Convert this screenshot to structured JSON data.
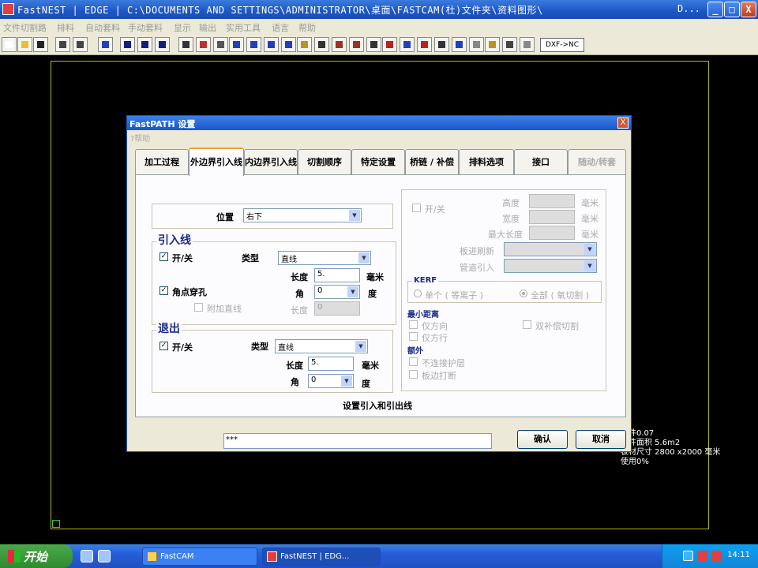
{
  "window": {
    "title": "FastNEST   |  EDGE   |  C:\\DOCUMENTS AND SETTINGS\\ADMINISTRATOR\\桌面\\FASTCAM(杜)文件夹\\资料图形\\",
    "title_suffix": "D...",
    "minimize": "_",
    "maximize": "□",
    "close": "X"
  },
  "menu": [
    "文件切割路",
    "排料",
    "自动套料",
    "手动套料",
    "显示",
    "输出",
    "实用工具",
    "语言",
    "帮助"
  ],
  "toolbar": {
    "dxf_label": "DXF->NC"
  },
  "canvas_info": {
    "line1": "零件0.07",
    "line2": "零件面积 5.6m2",
    "line3": "板材尺寸   2800 x2000 毫米",
    "line4": "使用0%"
  },
  "dialog": {
    "title": "FastPATH 设置",
    "help": "?帮助",
    "close": "X",
    "tabs": [
      {
        "label": "加工过程"
      },
      {
        "label": "外边界引入线"
      },
      {
        "label": "内边界引入线"
      },
      {
        "label": "切割顺序"
      },
      {
        "label": "特定设置"
      },
      {
        "label": "桥链 / 补偿"
      },
      {
        "label": "排料选项"
      },
      {
        "label": "接口"
      },
      {
        "label": "随动/转套"
      }
    ],
    "position": {
      "label": "位置",
      "value": "右下"
    },
    "leadin": {
      "title": "引入线",
      "onoff": "开/关",
      "type_label": "类型",
      "type_value": "直线",
      "length_label": "长度",
      "length_value": "5.",
      "length_unit": "毫米",
      "corner_pierce": "角点穿孔",
      "angle_label": "角",
      "angle_value": "0",
      "angle_unit": "度",
      "add_line": "附加直线",
      "add_length_label": "长度",
      "add_length_value": "0"
    },
    "leadout": {
      "title": "退出",
      "onoff": "开/关",
      "type_label": "类型",
      "type_value": "直线",
      "length_label": "长度",
      "length_value": "5.",
      "length_unit": "毫米",
      "angle_label": "角",
      "angle_value": "0",
      "angle_unit": "度"
    },
    "right": {
      "onoff": "开/关",
      "height_label": "高度",
      "width_label": "宽度",
      "maxlen_label": "最大长度",
      "unit": "毫米",
      "sel1_label": "板进刷新",
      "sel2_label": "管道引入",
      "kerf_title": "KERF",
      "kerf_single": "单个 ( 等离子 )",
      "kerf_all": "全部 ( 氧切割 )",
      "mindist_title": "最小距离",
      "only_square": "仅方向",
      "only_row": "仅方行",
      "double_comp": "双补偿切割",
      "extra_title": "额外",
      "no_protect": "不连接护层",
      "edge_cut": "板边打断"
    },
    "footer_note": "设置引入和引出线",
    "status_value": "***",
    "ok": "确认",
    "cancel": "取消"
  },
  "taskbar": {
    "start": "开始",
    "tasks": [
      {
        "label": "FastCAM"
      },
      {
        "label": "FastNEST   |  EDG..."
      }
    ],
    "clock": "14:11"
  }
}
